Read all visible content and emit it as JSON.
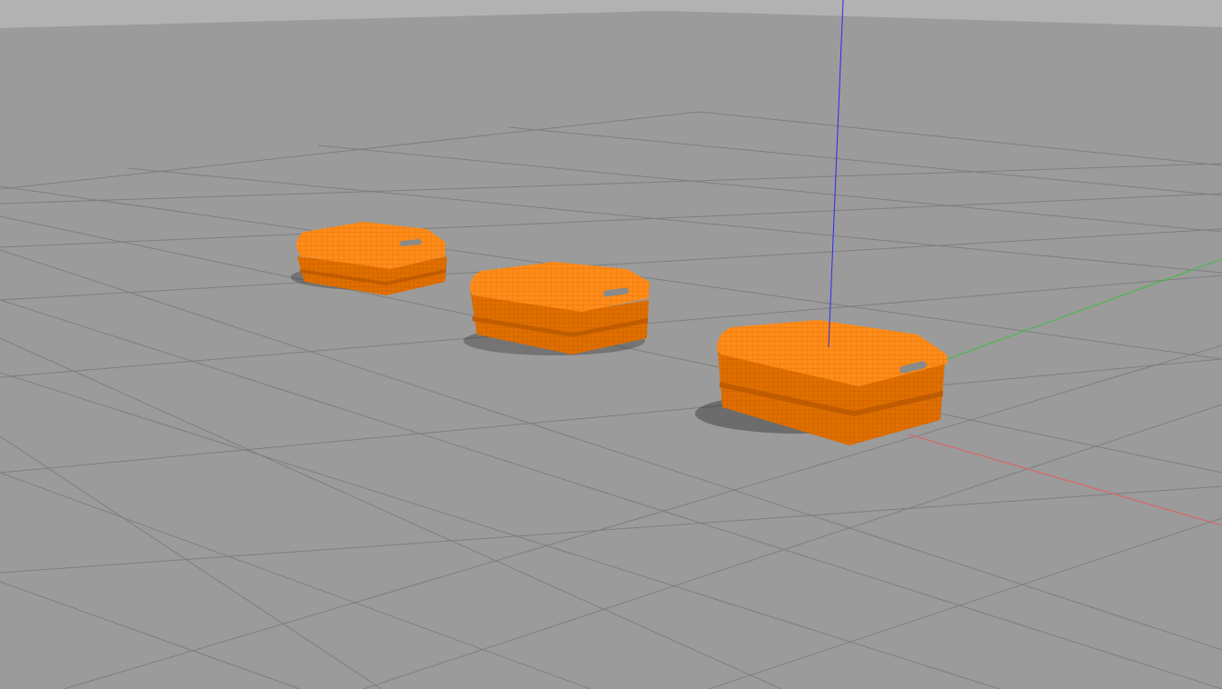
{
  "scene": {
    "type": "3d-simulation-viewport",
    "colors": {
      "sky": "#b2b2b2",
      "ground": "#9b9b9b",
      "grid": "#7e7e7e",
      "robot_body": "#ff8c1a",
      "robot_shade": "#e06f00",
      "robot_dark": "#c05c00",
      "axis_x": "#e06060",
      "axis_y": "#3fbf3f",
      "axis_z": "#2a2af0"
    },
    "objects": [
      {
        "kind": "mobile-robot",
        "icon": "robot-base"
      },
      {
        "kind": "mobile-robot",
        "icon": "robot-base"
      },
      {
        "kind": "mobile-robot",
        "icon": "robot-base"
      }
    ],
    "axes": [
      "x",
      "y",
      "z"
    ]
  }
}
